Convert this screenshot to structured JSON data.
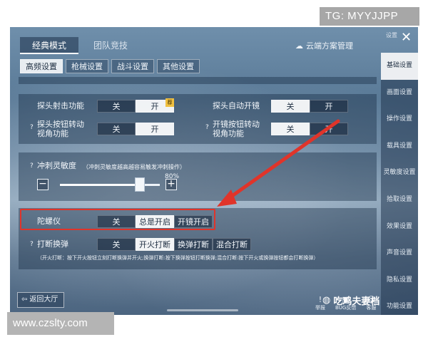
{
  "watermarks": {
    "top": "TG: MYYJJPP",
    "bottom": "www.czslty.com"
  },
  "header": {
    "tabs": [
      "经典模式",
      "团队竞技"
    ],
    "cloud_label": "云端方案管理",
    "mini_label": "设置",
    "close_glyph": "✕"
  },
  "sub_tabs": [
    "高频设置",
    "枪械设置",
    "战斗设置",
    "其他设置"
  ],
  "sidebar": [
    "基础设置",
    "画面设置",
    "操作设置",
    "载具设置",
    "灵敏度设置",
    "拾取设置",
    "效果设置",
    "声音设置",
    "隐私设置",
    "功能设置"
  ],
  "rows": {
    "peek_fire": {
      "label": "探头射击功能",
      "options": [
        "关",
        "开"
      ],
      "selected": 1,
      "badge": "荐"
    },
    "auto_scope": {
      "label": "探头自动开镜",
      "options": [
        "关",
        "开"
      ],
      "selected": 0
    },
    "peek_rotate": {
      "label_line1": "探头按钮转动",
      "label_line2": "视角功能",
      "options": [
        "关",
        "开"
      ],
      "selected": 1
    },
    "scope_rotate": {
      "label_line1": "开镜按钮转动",
      "label_line2": "视角功能",
      "options": [
        "关",
        "开"
      ],
      "selected": 0
    }
  },
  "sprint": {
    "label": "冲刺灵敏度",
    "hint": "（冲刺灵敏度越高越容易触发冲刺操作）",
    "value_text": "80%",
    "value": 80,
    "minus": "−",
    "plus": "+"
  },
  "gyro": {
    "label": "陀螺仪",
    "options": [
      "关",
      "总是开启",
      "开镜开启"
    ],
    "selected": 1
  },
  "reload": {
    "label": "打断换弹",
    "options": [
      "关",
      "开火打断",
      "换弹打断",
      "混合打断"
    ],
    "selected": 1,
    "note": "（开火打断：按下开火按钮立刻打断换弹并开火;换弹打断:按下换弹按钮打断换弹;混合打断:按下开火或换弹按钮都会打断换弹）"
  },
  "help_glyph": "?",
  "footer": {
    "back_label": "返回大厅",
    "icons": [
      {
        "glyph": "!",
        "label": "举报"
      },
      {
        "glyph": "▣",
        "label": "BUG反馈"
      },
      {
        "glyph": "☺",
        "label": "客服"
      }
    ],
    "brand": "吃鸡夫妻档"
  },
  "colors": {
    "highlight": "#e0342a",
    "arrow": "#e0342a",
    "badge": "#f0c040"
  }
}
